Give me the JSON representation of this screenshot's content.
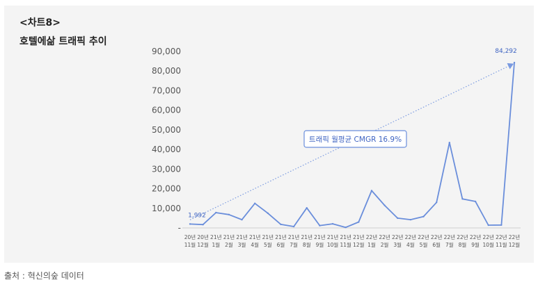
{
  "header": {
    "tag": "<차트8>",
    "title": "호텔에삶 트래픽 추이"
  },
  "source": "출처 : 혁신의숲 데이터",
  "chart_data": {
    "type": "line",
    "title": "호텔에삶 트래픽 추이",
    "ylim": [
      0,
      90000
    ],
    "yticks": [
      "-",
      "10,000",
      "20,000",
      "30,000",
      "40,000",
      "50,000",
      "60,000",
      "70,000",
      "80,000",
      "90,000"
    ],
    "x_top": [
      "20년",
      "20년",
      "21년",
      "21년",
      "21년",
      "21년",
      "21년",
      "21년",
      "21년",
      "21년",
      "21년",
      "21년",
      "21년",
      "21년",
      "22년",
      "22년",
      "22년",
      "22년",
      "22년",
      "22년",
      "22년",
      "22년",
      "22년",
      "22년",
      "22년",
      "22년"
    ],
    "x_bottom": [
      "11월",
      "12월",
      "1월",
      "2월",
      "3월",
      "4월",
      "5월",
      "6월",
      "7월",
      "8월",
      "9월",
      "10월",
      "11월",
      "12월",
      "1월",
      "2월",
      "3월",
      "4월",
      "5월",
      "6월",
      "7월",
      "8월",
      "9월",
      "10월",
      "11월",
      "12월"
    ],
    "values": [
      1992,
      1700,
      7800,
      6800,
      4200,
      12500,
      7500,
      1800,
      700,
      10200,
      1200,
      2100,
      300,
      3000,
      19000,
      11500,
      5000,
      4200,
      5800,
      13000,
      43500,
      14800,
      13500,
      1400,
      1500,
      84292
    ],
    "point_labels": [
      {
        "index": 0,
        "text": "1,992"
      },
      {
        "index": 25,
        "text": "84,292"
      }
    ],
    "trend_annotation": "트래픽 월평균 CMGR 16.9%",
    "colors": {
      "line": "#6a8edb",
      "label": "#3f64c2",
      "trend": "#7a9ae0"
    },
    "grid": false
  }
}
